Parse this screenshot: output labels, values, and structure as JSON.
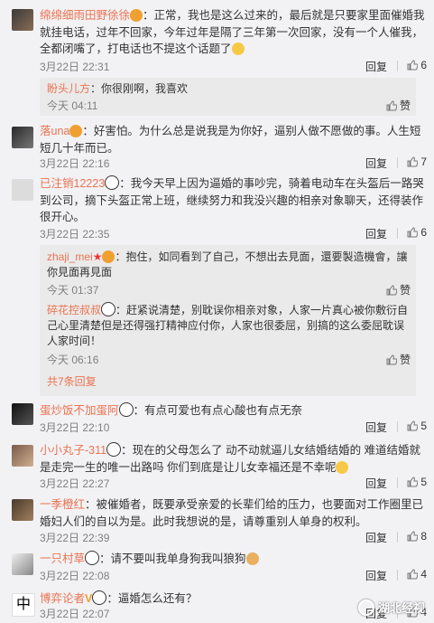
{
  "comments": [
    {
      "user": "绵绵细雨田野徐徐",
      "text": "正常，我也是这么过来的，最后就是只要家里面催婚我就挂电话，过年不回家，今年过年是隔了三年第一次回家，没有一个人催我，全都闭嘴了，打电话也不提这个话题了",
      "time": "3月22日 22:31",
      "reply": "回复",
      "likes": "6",
      "replies": [
        {
          "user": "盼头儿方",
          "text": "你很刚啊，我喜欢",
          "time": "今天 04:11",
          "likes": "赞"
        }
      ]
    },
    {
      "user": "落una",
      "text": "好害怕。为什么总是说我是为你好，逼别人做不愿做的事。人生短短几十年而已。",
      "time": "3月22日 22:16",
      "reply": "回复",
      "likes": "7"
    },
    {
      "user": "已注销12223",
      "text": "我今天早上因为逼婚的事吵完，骑着电动车在头盔后一路哭到公司，摘下头盔正常上班，继续努力和我没兴趣的相亲对象聊天，还得装作很开心。",
      "time": "3月22日 22:35",
      "reply": "回复",
      "likes": "6",
      "replies": [
        {
          "user": "zhaji_mei",
          "text": "抱住，如同看到了自己，不想出去見面，還要製造機會，讓你見面再見面",
          "time": "今天 01:37",
          "likes": "赞"
        },
        {
          "user": "碎花控叔叔",
          "text": "赶紧说清楚，别耽误你相亲对象，人家一片真心被你敷衍自己心里清楚但是还得强打精神应付你，人家也很委屈，别搞的这么委屈耽误人家时间！",
          "time": "今天 06:16",
          "likes": "赞"
        }
      ],
      "more": "共7条回复"
    },
    {
      "user": "蛋炒饭不加蛋阿",
      "text": "有点可爱也有点心酸也有点无奈",
      "time": "3月22日 22:10",
      "reply": "回复",
      "likes": "5"
    },
    {
      "user": "小小丸子-311",
      "text": "现在的父母怎么了 动不动就逼儿女结婚结婚的  难道结婚就是走完一生的唯一出路吗 你们到底是让儿女幸福还是不幸呢",
      "time": "3月22日 22:27",
      "reply": "回复",
      "likes": "5"
    },
    {
      "user": "一季橙红",
      "text": "被催婚者，既要承受亲爱的长辈们给的压力，也要面对工作圈里已婚妇人们的自以为是。此时我想说的是，请尊重别人单身的权利。",
      "time": "3月22日 22:39",
      "reply": "回复",
      "likes": "8"
    },
    {
      "user": "一只村草",
      "text": "请不要叫我单身狗我叫狼狗",
      "time": "3月22日 22:08",
      "reply": "回复",
      "likes": "4"
    },
    {
      "user": "博弈论者",
      "text": "逼婚怎么还有？",
      "time": "3月22日 22:07",
      "reply": "回复",
      "likes": "4"
    }
  ],
  "watermark": "湖北经视"
}
